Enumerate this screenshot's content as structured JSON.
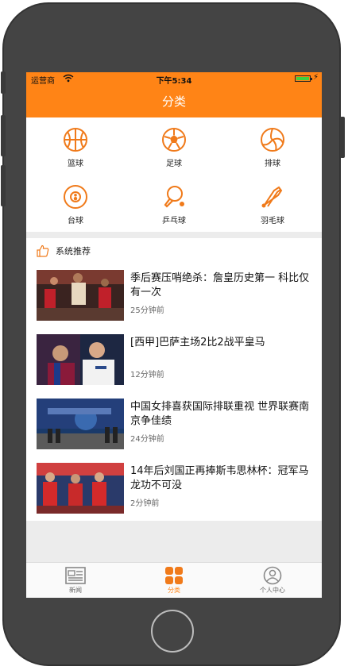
{
  "status": {
    "carrier": "运营商",
    "time": "下午5:34"
  },
  "nav": {
    "title": "分类"
  },
  "categories": [
    {
      "label": "篮球",
      "icon": "basketball-icon"
    },
    {
      "label": "足球",
      "icon": "soccer-ball-icon"
    },
    {
      "label": "排球",
      "icon": "volleyball-icon"
    },
    {
      "label": "台球",
      "icon": "billiards-ball-icon"
    },
    {
      "label": "乒乓球",
      "icon": "ping-pong-icon"
    },
    {
      "label": "羽毛球",
      "icon": "badminton-icon"
    }
  ],
  "recommend": {
    "heading": "系统推荐"
  },
  "news": [
    {
      "title": "季后赛压哨绝杀：詹皇历史第一 科比仅有一次",
      "time": "25分钟前"
    },
    {
      "title": "[西甲]巴萨主场2比2战平皇马",
      "time": "12分钟前"
    },
    {
      "title": "中国女排喜获国际排联重视 世界联赛南京争佳绩",
      "time": "24分钟前"
    },
    {
      "title": "14年后刘国正再捧斯韦思林杯：冠军马龙功不可没",
      "time": "2分钟前"
    }
  ],
  "tabbar": [
    {
      "label": "新闻",
      "icon": "news-icon"
    },
    {
      "label": "分类",
      "icon": "category-grid-icon"
    },
    {
      "label": "个人中心",
      "icon": "profile-icon"
    }
  ],
  "colors": {
    "accent": "#ff8416",
    "background": "#f0f0f0"
  }
}
